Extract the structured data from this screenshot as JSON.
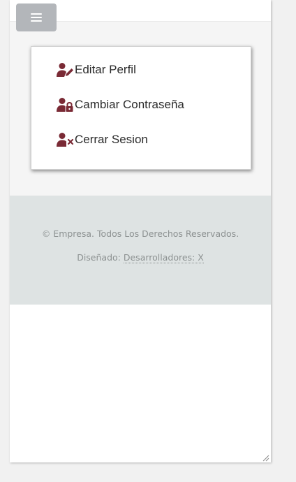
{
  "menu": {
    "toggle_icon": "hamburger-icon",
    "items": [
      {
        "label": "Editar Perfil",
        "icon": "user-edit-icon"
      },
      {
        "label": "Cambiar Contraseña",
        "icon": "user-lock-icon"
      },
      {
        "label": "Cerrar Sesion",
        "icon": "user-times-icon"
      }
    ],
    "icon_color": "#7a2a35"
  },
  "footer": {
    "copyright": "© Empresa. Todos Los Derechos Reservados.",
    "designed_prefix": "Diseñado:",
    "designed_link": "Desarrolladores: X"
  }
}
